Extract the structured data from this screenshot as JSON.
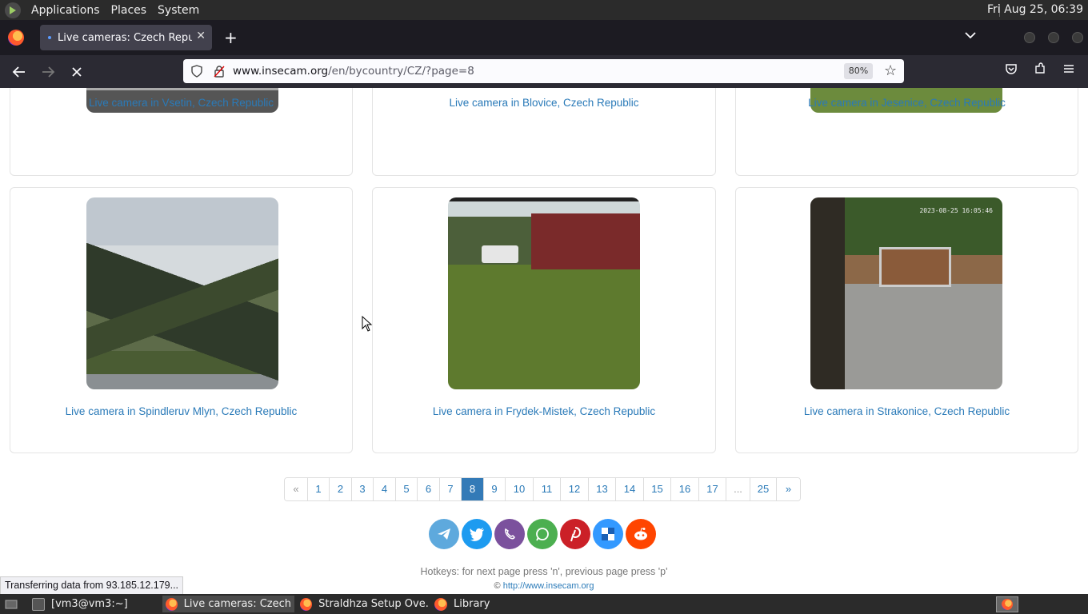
{
  "top_panel": {
    "menus": [
      "Applications",
      "Places",
      "System"
    ],
    "clock": "Fri Aug 25, 06:39"
  },
  "browser": {
    "tab_title": "Live cameras: Czech Republ",
    "url_host": "www.insecam.org",
    "url_path": "/en/bycountry/CZ/?page=8",
    "zoom": "80%"
  },
  "cameras": {
    "row1": [
      {
        "caption": "Live camera in Vsetin, Czech Republic"
      },
      {
        "caption": "Live camera in Blovice, Czech Republic"
      },
      {
        "caption": "Live camera in Jesenice, Czech Republic"
      }
    ],
    "row2": [
      {
        "caption": "Live camera in Spindleruv Mlyn, Czech Republic",
        "stamp": ""
      },
      {
        "caption": "Live camera in Frydek-Mistek, Czech Republic",
        "stamp": ""
      },
      {
        "caption": "Live camera in Strakonice, Czech Republic",
        "stamp": "2023-08-25 16:05:46"
      }
    ]
  },
  "pagination": {
    "prev": "«",
    "pages": [
      "1",
      "2",
      "3",
      "4",
      "5",
      "6",
      "7",
      "8",
      "9",
      "10",
      "11",
      "12",
      "13",
      "14",
      "15",
      "16",
      "17",
      "...",
      "25"
    ],
    "active": "8",
    "next": "»"
  },
  "social": {
    "telegram": "telegram-icon",
    "twitter": "twitter-icon",
    "viber": "viber-icon",
    "whatsapp": "whatsapp-icon",
    "pinterest": "pinterest-icon",
    "delicious": "delicious-icon",
    "reddit": "reddit-icon",
    "colors": {
      "telegram": "#5ea9dd",
      "twitter": "#1d9bf0",
      "viber": "#7b519d",
      "whatsapp": "#4caf50",
      "pinterest": "#cb2027",
      "delicious": "#3399ff",
      "reddit": "#ff4500"
    }
  },
  "footer": {
    "hotkeys": "Hotkeys: for next page press 'n', previous page press 'p'",
    "copyright_symbol": "©",
    "link": "http://www.insecam.org"
  },
  "status_bar": "Transferring data from 93.185.12.179...",
  "taskbar": {
    "items": [
      "[vm3@vm3:~]",
      "Live cameras: Czech ...",
      "Straldhza Setup Ove...",
      "Library"
    ]
  }
}
